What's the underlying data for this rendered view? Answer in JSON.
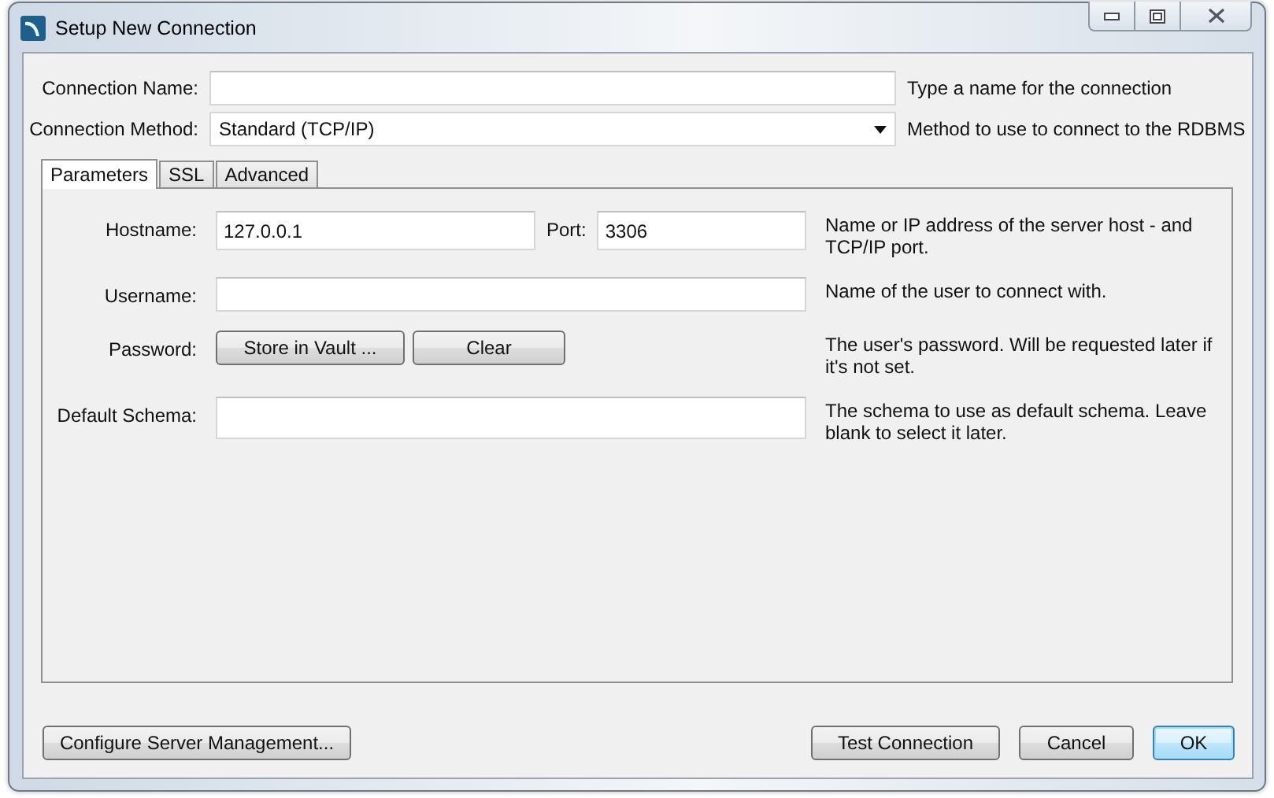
{
  "window": {
    "title": "Setup New Connection"
  },
  "connection_name": {
    "label": "Connection Name:",
    "hint": "Type a name for the connection"
  },
  "connection_method": {
    "label": "Connection Method:",
    "value": "Standard (TCP/IP)",
    "hint": "Method to use to connect to the RDBMS"
  },
  "tabs": [
    {
      "label": "Parameters",
      "selected": true
    },
    {
      "label": "SSL",
      "selected": false
    },
    {
      "label": "Advanced",
      "selected": false
    }
  ],
  "rows": [
    {
      "kind": "field",
      "label": "Hostname:",
      "value": "127.0.0.1",
      "port": {
        "label": "Port:",
        "value": "3306"
      },
      "hint": "Name or IP address of the server host - and TCP/IP port."
    },
    {
      "kind": "field",
      "label": "Username:",
      "hint": "Name of the user to connect with."
    },
    {
      "kind": "buttons",
      "label": "Password:",
      "buttons": [
        "Store in Vault ...",
        "Clear"
      ],
      "hint": "The user's password. Will be requested later if it's not set."
    },
    {
      "kind": "field",
      "label": "Default Schema:",
      "hint": "The schema to use as default schema. Leave blank to select it later."
    }
  ],
  "footer": {
    "left_buttons": [
      {
        "label": "Configure Server Management...",
        "default": false
      }
    ],
    "right_buttons": [
      {
        "label": "Test Connection",
        "default": false
      },
      {
        "label": "Cancel",
        "default": false
      },
      {
        "label": "OK",
        "default": true
      }
    ]
  }
}
